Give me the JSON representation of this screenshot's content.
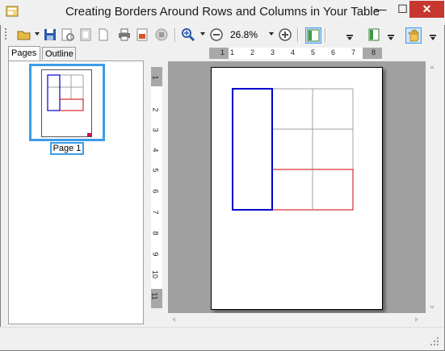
{
  "window": {
    "title": "Creating Borders Around Rows and Columns in Your Table",
    "minimize_glyph": "—",
    "maximize_glyph": "☐",
    "close_glyph": "✕"
  },
  "toolbar": {
    "zoom_value": "26.8%",
    "icons": [
      "open-folder-icon",
      "save-icon",
      "print-preview-icon",
      "page-setup-icon",
      "new-page-icon",
      "print-icon",
      "export-icon",
      "stop-icon",
      "zoom-in-icon",
      "zoom-out-icon",
      "zoom-add-icon",
      "thumbnails-toggle-icon",
      "single-page-icon",
      "hand-tool-icon"
    ]
  },
  "tabs": [
    {
      "label": "Pages"
    },
    {
      "label": "Outline"
    }
  ],
  "thumbnails": [
    {
      "label": "Page 1"
    }
  ],
  "rulers": {
    "horizontal": [
      "1",
      "1",
      "2",
      "3",
      "4",
      "5",
      "6",
      "7",
      "8"
    ],
    "vertical": [
      "1",
      "2",
      "3",
      "4",
      "5",
      "6",
      "7",
      "8",
      "9",
      "10",
      "11"
    ]
  },
  "colors": {
    "selection": "#3d9be9",
    "column_border": "#0000cc",
    "row_border": "#cc0000",
    "grid": "#a0a0a0"
  }
}
